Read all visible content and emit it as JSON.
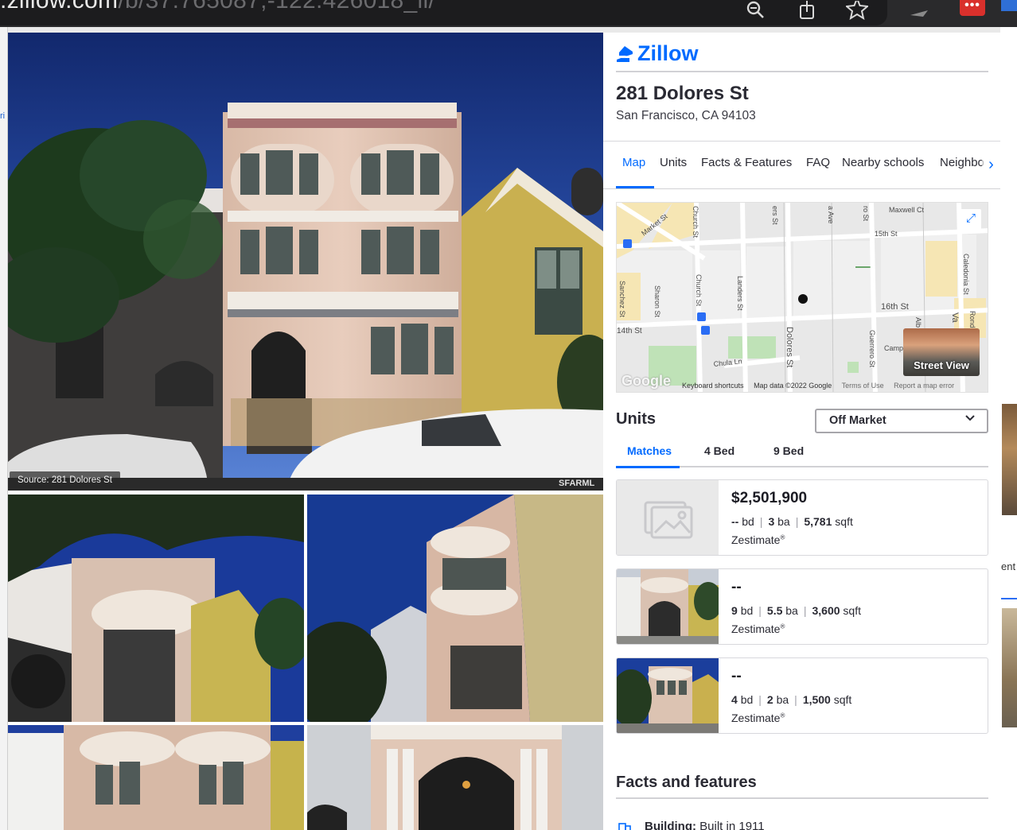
{
  "browser": {
    "url_domain": ".zillow.com",
    "url_path": "/b/37.765087,-122.426018_ll/"
  },
  "photos": {
    "source_caption": "Source: 281 Dolores St",
    "watermark": "SFARML"
  },
  "panel": {
    "logo_text": "Zillow",
    "address": "281 Dolores St",
    "city_state_zip": "San Francisco, CA 94103",
    "tabs": [
      {
        "label": "Map",
        "active": true
      },
      {
        "label": "Units"
      },
      {
        "label": "Facts & Features"
      },
      {
        "label": "FAQ"
      },
      {
        "label": "Nearby schools"
      },
      {
        "label": "Neighbo"
      }
    ]
  },
  "map": {
    "streets": [
      "Market St",
      "Church St",
      "Church St",
      "Sharon St",
      "Landers St",
      "Dolores St",
      "Guerrero St",
      "Caledonia St",
      "15th St",
      "16th St",
      "Maxwell Ct",
      "Chula Ln",
      "Sanchez St",
      "14th St",
      "Camp",
      "Valencia",
      "Rondel Pl",
      "ers St",
      "a Ave",
      "ro St",
      "Alb",
      "Va"
    ],
    "street_view_label": "Street View",
    "google_label": "Google",
    "footer": [
      "Keyboard shortcuts",
      "Map data ©2022 Google",
      "Terms of Use",
      "Report a map error"
    ]
  },
  "units": {
    "title": "Units",
    "filter_selected": "Off Market",
    "subtabs": [
      "Matches",
      "4 Bed",
      "9 Bed"
    ],
    "items": [
      {
        "price": "$2,501,900",
        "bd": "--",
        "ba": "3",
        "sqft": "5,781",
        "zestimate": "Zestimate"
      },
      {
        "price": "--",
        "bd": "9",
        "ba": "5.5",
        "sqft": "3,600",
        "zestimate": "Zestimate"
      },
      {
        "price": "--",
        "bd": "4",
        "ba": "2",
        "sqft": "1,500",
        "zestimate": "Zestimate"
      }
    ],
    "bd_unit": "bd",
    "ba_unit": "ba",
    "sqft_unit": "sqft",
    "registered": "®"
  },
  "facts": {
    "title": "Facts and features",
    "building_label": "Building:",
    "building_value": "Built in 1911"
  },
  "background_page": {
    "partial_text": "ent",
    "partial_left": "ri"
  },
  "colors": {
    "accent": "#006aff",
    "text": "#2a2a33"
  }
}
